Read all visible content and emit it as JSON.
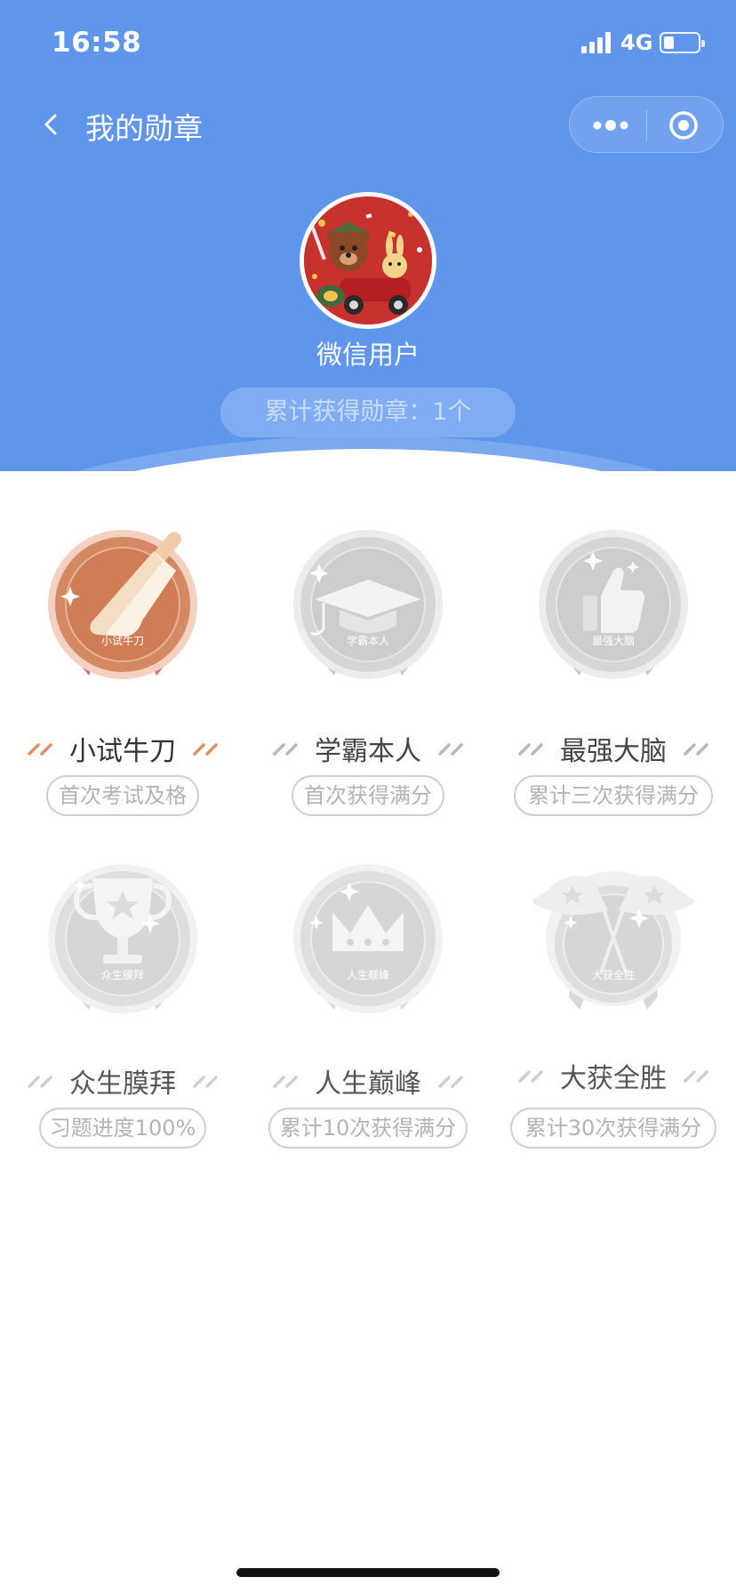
{
  "status_bar": {
    "time": "16:58",
    "network": "4G",
    "battery_level": 0.3
  },
  "nav": {
    "title": "我的勋章"
  },
  "profile": {
    "username": "微信用户",
    "count_text": "累计获得勋章：1个"
  },
  "colors": {
    "header_blue": "#5f96ec",
    "bronze": "#d9906a",
    "ribbon_red": "#e0707a",
    "silver": "#d0d0d0"
  },
  "badges": [
    {
      "title": "小试牛刀",
      "medal_text": "小试牛刀",
      "desc": "首次考试及格",
      "earned": true,
      "icon": "cleaver-icon"
    },
    {
      "title": "学霸本人",
      "medal_text": "学霸本人",
      "desc": "首次获得满分",
      "earned": false,
      "icon": "graduation-cap-icon"
    },
    {
      "title": "最强大脑",
      "medal_text": "最强大脑",
      "desc": "累计三次获得满分",
      "earned": false,
      "icon": "thumbs-up-icon"
    },
    {
      "title": "众生膜拜",
      "medal_text": "众生膜拜",
      "desc": "习题进度100%",
      "earned": false,
      "icon": "trophy-icon"
    },
    {
      "title": "人生巅峰",
      "medal_text": "人生巅峰",
      "desc": "累计10次获得满分",
      "earned": false,
      "icon": "crown-icon"
    },
    {
      "title": "大获全胜",
      "medal_text": "大获全胜",
      "desc": "累计30次获得满分",
      "earned": false,
      "icon": "crossed-flags-icon"
    }
  ]
}
